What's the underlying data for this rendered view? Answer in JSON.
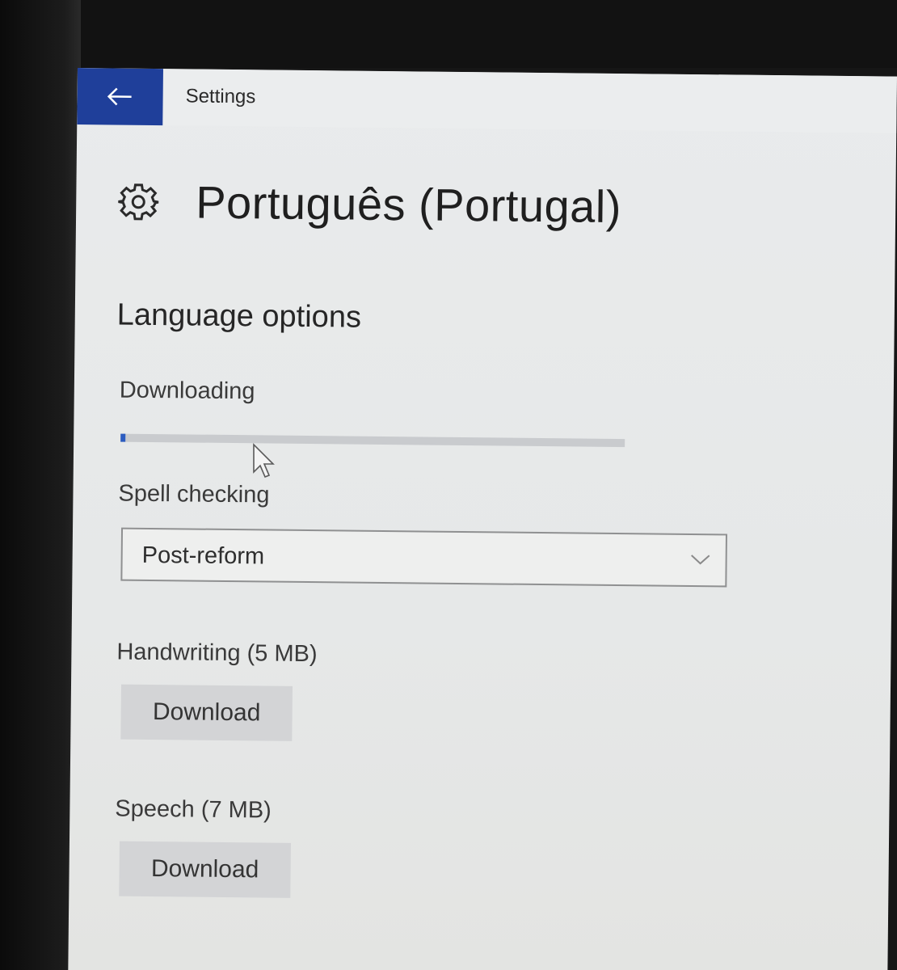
{
  "window": {
    "title": "Settings",
    "back_icon": "back-arrow-icon",
    "accent": "#1f3f9a"
  },
  "page": {
    "icon": "gear-icon",
    "title": "Português (Portugal)"
  },
  "language_options": {
    "section_title": "Language options",
    "download_status": {
      "label": "Downloading",
      "progress_fraction": 0.01
    },
    "spell_checking": {
      "label": "Spell checking",
      "selected": "Post-reform",
      "icon": "chevron-down-icon"
    },
    "handwriting": {
      "label": "Handwriting (5 MB)",
      "button_label": "Download"
    },
    "speech": {
      "label": "Speech (7 MB)",
      "button_label": "Download"
    }
  }
}
